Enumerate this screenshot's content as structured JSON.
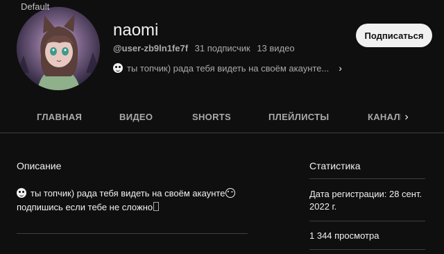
{
  "channel": {
    "avatar_overlay_text": "Default",
    "name": "naomi",
    "handle": "@user-zb9ln1fe7f",
    "subscribers": "31 подписчик",
    "videos": "13 видео",
    "tagline": "ты топчик) рада тебя видеть на своём акаунте..."
  },
  "subscribe_button": {
    "label": "Подписаться"
  },
  "tabs": [
    {
      "label": "ГЛАВНАЯ"
    },
    {
      "label": "ВИДЕО"
    },
    {
      "label": "SHORTS"
    },
    {
      "label": "ПЛЕЙЛИСТЫ"
    },
    {
      "label": "КАНАЛЫ"
    }
  ],
  "description": {
    "title": "Описание",
    "line1": "ты топчик) рада тебя видеть на своём акаунте",
    "line2": "подпишись если тебе не сложно"
  },
  "stats": {
    "title": "Статистика",
    "registration": "Дата регистрации: 28 сент. 2022 г.",
    "views": "1 344 просмотра"
  },
  "icons": {
    "tagline_emoji": "smiling-face-heart-eyes-icon",
    "tagline_chevron": "chevron-right-icon",
    "tabs_next": "chevron-right-icon",
    "desc_emoji_start": "smiling-face-heart-eyes-icon",
    "desc_emoji_end": "winking-face-icon",
    "desc_box_glyph": "unknown-glyph-icon"
  }
}
